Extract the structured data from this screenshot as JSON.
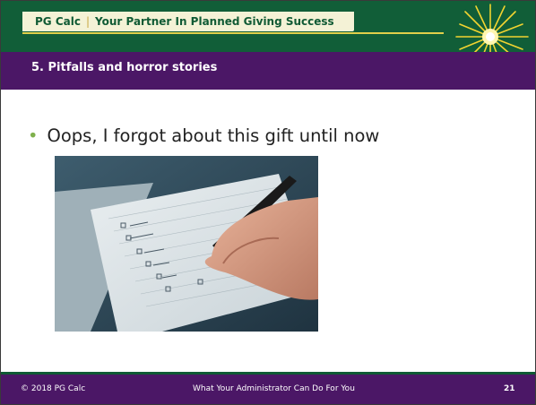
{
  "header": {
    "brand": "PG Calc",
    "separator": "|",
    "tagline": "Your Partner In Planned Giving Success"
  },
  "section": {
    "title": "5. Pitfalls and horror stories"
  },
  "content": {
    "bullet": "Oops, I forgot about this gift until now",
    "photo_alt": "Hand writing in a checklist notebook"
  },
  "footer": {
    "copyright": "© 2018 PG Calc",
    "title": "What Your Administrator Can Do For You",
    "page_number": "21"
  },
  "colors": {
    "header_green": "#115e38",
    "section_purple": "#4b1766",
    "accent_gold": "#e1cf4a",
    "bullet_green": "#7fb04c"
  }
}
